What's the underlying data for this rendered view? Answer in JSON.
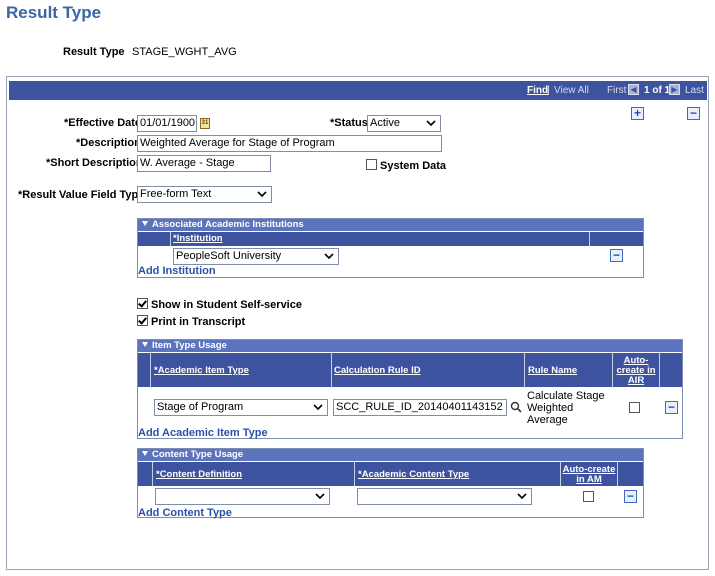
{
  "page": {
    "title": "Result Type",
    "result_type_label": "Result Type",
    "result_type_value": "STAGE_WGHT_AVG"
  },
  "nav": {
    "find": "Find",
    "separator": "|",
    "view_all": "View All",
    "first": "First",
    "count": "1 of 1",
    "last": "Last"
  },
  "form": {
    "effective_date_label": "*Effective Date",
    "effective_date_value": "01/01/1900",
    "calendar_glyph": "31",
    "status_label": "*Status",
    "status_value": "Active",
    "description_label": "*Description",
    "description_value": "Weighted Average for Stage of Program",
    "short_description_label": "*Short Description",
    "short_description_value": "W. Average - Stage",
    "system_data_label": "System Data",
    "result_value_field_type_label": "*Result Value Field Type",
    "result_value_field_type_value": "Free-form Text",
    "show_self_service_label": "Show in Student Self-service",
    "print_transcript_label": "Print in Transcript"
  },
  "institutions_grid": {
    "title": "Associated Academic Institutions",
    "col_institution": "*Institution",
    "row_institution_value": "PeopleSoft University",
    "add_link": "Add Institution"
  },
  "item_type_grid": {
    "title": "Item Type Usage",
    "col_item_type": "*Academic Item Type",
    "col_calc_rule": "Calculation Rule ID",
    "col_rule_name": "Rule Name",
    "col_auto_create_1": "Auto-",
    "col_auto_create_2": "create in",
    "col_auto_create_3": "AIR",
    "row_item_type_value": "Stage of Program",
    "row_calc_rule_value": "SCC_RULE_ID_20140401143152",
    "row_rule_name_1": "Calculate Stage",
    "row_rule_name_2": "Weighted",
    "row_rule_name_3": "Average",
    "add_link": "Add Academic Item Type"
  },
  "content_type_grid": {
    "title": "Content Type Usage",
    "col_content_def": "*Content Definition",
    "col_content_type": "*Academic Content Type",
    "col_auto_create_1": "Auto-create",
    "col_auto_create_2": "in AM",
    "row_content_def_value": "",
    "row_content_type_value": "",
    "add_link": "Add Content Type"
  },
  "colors": {
    "title": "#3a64a8",
    "nav_bar": "#3e53a0",
    "grid_header": "#5b74bd",
    "link": "#2a52a8"
  },
  "icons": [
    "plus-icon",
    "minus-icon",
    "calendar-icon",
    "lookup-icon",
    "chevron-down-icon",
    "arrow-left-icon",
    "arrow-right-icon"
  ]
}
